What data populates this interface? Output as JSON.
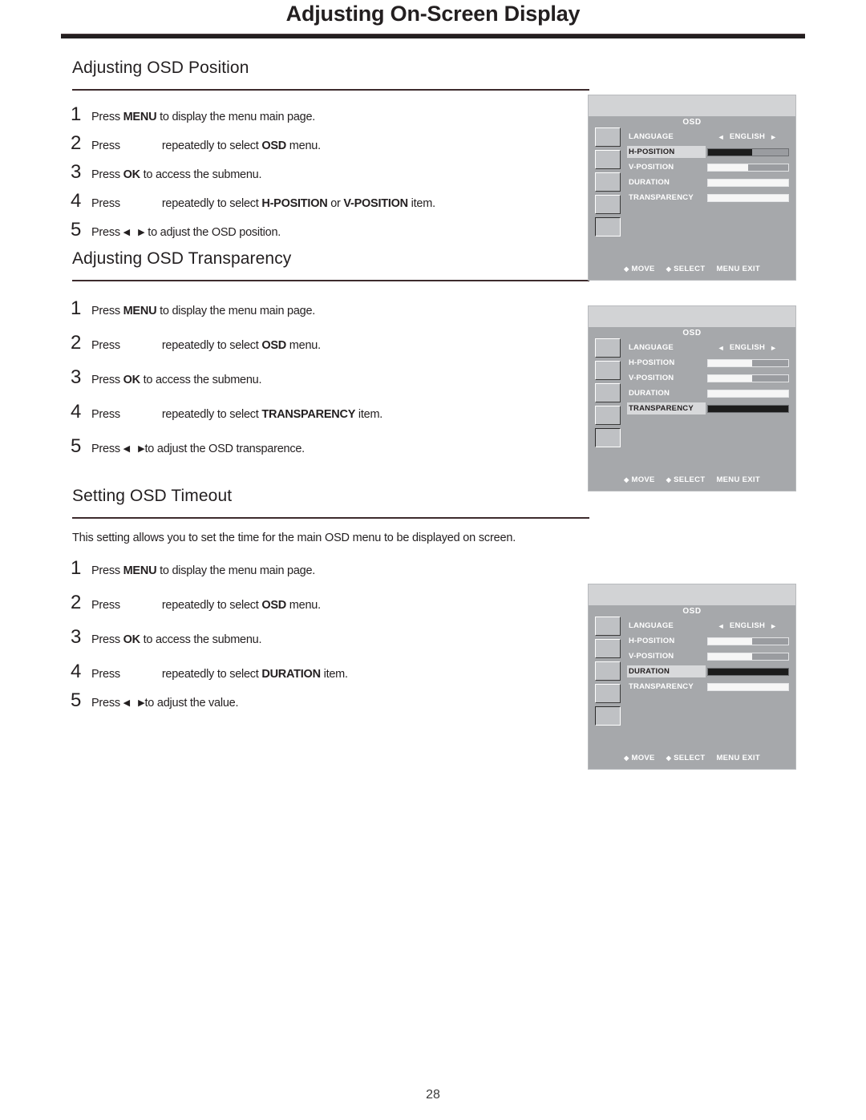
{
  "page": {
    "title": "Adjusting On-Screen Display",
    "number": "28"
  },
  "sections": [
    {
      "heading": "Adjusting OSD Position",
      "intro": "",
      "steps": [
        {
          "num": "1",
          "pre": "Press ",
          "bold": "MENU",
          "post": " to display the menu main page.",
          "icon": "none"
        },
        {
          "num": "2",
          "pre": "Press",
          "bold": "OSD",
          "post": " menu.",
          "mid": "repeatedly to select ",
          "icon": "gap"
        },
        {
          "num": "3",
          "pre": "Press ",
          "bold": "OK",
          "post": " to access the submenu.",
          "icon": "none"
        },
        {
          "num": "4",
          "pre": "Press",
          "bold": "H-POSITION",
          "bold2": "V-POSITION",
          "mid": "repeatedly to select ",
          "joiner": " or ",
          "post": " item.",
          "icon": "gap"
        },
        {
          "num": "5",
          "pre": "Press ",
          "post": " to adjust the OSD position.",
          "icon": "leftright"
        }
      ]
    },
    {
      "heading": "Adjusting OSD Transparency",
      "intro": "",
      "steps": [
        {
          "num": "1",
          "pre": "Press ",
          "bold": "MENU",
          "post": " to display the menu main page.",
          "icon": "none"
        },
        {
          "num": "2",
          "pre": "Press",
          "bold": "OSD",
          "post": " menu.",
          "mid": "repeatedly to select ",
          "icon": "gap"
        },
        {
          "num": "3",
          "pre": "Press ",
          "bold": "OK",
          "post": " to access the submenu.",
          "icon": "none"
        },
        {
          "num": "4",
          "pre": "Press",
          "bold": "TRANSPARENCY",
          "mid": "repeatedly to select ",
          "post": " item.",
          "icon": "gap"
        },
        {
          "num": "5",
          "pre": "Press ",
          "post": "to adjust the OSD transparence.",
          "icon": "leftright"
        }
      ]
    },
    {
      "heading": "Setting OSD  Timeout",
      "intro": "This setting allows you to set the time for the main OSD menu to be displayed on screen.",
      "steps": [
        {
          "num": "1",
          "pre": "Press ",
          "bold": "MENU",
          "post": " to display the menu main page.",
          "icon": "none"
        },
        {
          "num": "2",
          "pre": "Press",
          "bold": "OSD",
          "post": " menu.",
          "mid": "repeatedly to select ",
          "icon": "gap"
        },
        {
          "num": "3",
          "pre": "Press ",
          "bold": "OK",
          "post": " to access the submenu.",
          "icon": "none"
        },
        {
          "num": "4",
          "pre": "Press",
          "bold": "DURATION",
          "mid": "repeatedly to select ",
          "post": " item.",
          "icon": "gap"
        },
        {
          "num": "5",
          "pre": "Press ",
          "post": "to adjust the value.",
          "icon": "leftright"
        }
      ]
    }
  ],
  "osd_panels": [
    {
      "title": "OSD",
      "selected_item": "H-POSITION",
      "rows": [
        {
          "label": "LANGUAGE",
          "type": "choice",
          "left_arrow": "◄",
          "value": "ENGLISH",
          "right_arrow": "►"
        },
        {
          "label": "H-POSITION",
          "type": "bar",
          "fill_pct": 55,
          "style": "dark",
          "selected": true
        },
        {
          "label": "V-POSITION",
          "type": "bar",
          "fill_pct": 50,
          "style": "light",
          "selected": false
        },
        {
          "label": "DURATION",
          "type": "bar",
          "fill_pct": 100,
          "style": "light",
          "selected": false
        },
        {
          "label": "TRANSPARENCY",
          "type": "bar",
          "fill_pct": 100,
          "style": "light",
          "selected": false
        }
      ],
      "footer": [
        {
          "glyph": "◆",
          "label": "MOVE"
        },
        {
          "glyph": "◆",
          "label": "SELECT"
        },
        {
          "glyph": "",
          "label": "MENU"
        },
        {
          "glyph": "",
          "label": "EXIT"
        }
      ]
    },
    {
      "title": "OSD",
      "selected_item": "TRANSPARENCY",
      "rows": [
        {
          "label": "LANGUAGE",
          "type": "choice",
          "left_arrow": "◄",
          "value": "ENGLISH",
          "right_arrow": "►"
        },
        {
          "label": "H-POSITION",
          "type": "bar",
          "fill_pct": 55,
          "style": "light",
          "selected": false
        },
        {
          "label": "V-POSITION",
          "type": "bar",
          "fill_pct": 55,
          "style": "light",
          "selected": false
        },
        {
          "label": "DURATION",
          "type": "bar",
          "fill_pct": 100,
          "style": "light",
          "selected": false
        },
        {
          "label": "TRANSPARENCY",
          "type": "bar",
          "fill_pct": 100,
          "style": "dark",
          "selected": true
        }
      ],
      "footer": [
        {
          "glyph": "◆",
          "label": "MOVE"
        },
        {
          "glyph": "◆",
          "label": "SELECT"
        },
        {
          "glyph": "",
          "label": "MENU"
        },
        {
          "glyph": "",
          "label": "EXIT"
        }
      ]
    },
    {
      "title": "OSD",
      "selected_item": "DURATION",
      "rows": [
        {
          "label": "LANGUAGE",
          "type": "choice",
          "left_arrow": "◄",
          "value": "ENGLISH",
          "right_arrow": "►"
        },
        {
          "label": "H-POSITION",
          "type": "bar",
          "fill_pct": 55,
          "style": "light",
          "selected": false
        },
        {
          "label": "V-POSITION",
          "type": "bar",
          "fill_pct": 55,
          "style": "light",
          "selected": false
        },
        {
          "label": "DURATION",
          "type": "bar",
          "fill_pct": 100,
          "style": "dark",
          "selected": true
        },
        {
          "label": "TRANSPARENCY",
          "type": "bar",
          "fill_pct": 100,
          "style": "light",
          "selected": false
        }
      ],
      "footer": [
        {
          "glyph": "◆",
          "label": "MOVE"
        },
        {
          "glyph": "◆",
          "label": "SELECT"
        },
        {
          "glyph": "",
          "label": "MENU"
        },
        {
          "glyph": "",
          "label": "EXIT"
        }
      ]
    }
  ],
  "colors": {
    "rule": "#231f20",
    "osd_body": "#a6a8ab",
    "osd_strip": "#d2d3d5",
    "osd_selected_bg": "#d8d9db",
    "bar_fill_light": "#f6f6f6",
    "bar_fill_dark": "#1c1c1c"
  }
}
